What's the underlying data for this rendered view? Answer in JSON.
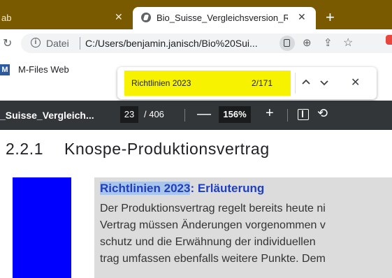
{
  "browser": {
    "prev_tab_label": "ab",
    "active_tab_label": "Bio_Suisse_Vergleichsversion_Ricl",
    "close_glyph": "✕",
    "new_tab_glyph": "+",
    "address": {
      "scheme_label": "Datei",
      "url": "C:/Users/benjamin.janisch/Bio%20Sui..."
    },
    "bookmark": {
      "icon_letter": "M",
      "label": "M-Files Web"
    }
  },
  "find_bar": {
    "query": "Richtlinien 2023",
    "count": "2/171",
    "highlight_color": "#f7f200"
  },
  "pdf_toolbar": {
    "title": "_Suisse_Vergleich...",
    "current_page": "23",
    "total_pages": "/ 406",
    "zoom": "156%"
  },
  "document": {
    "section_number": "2.2.1",
    "section_title": "Knospe-Produktionsvertrag",
    "note_title_highlight": "Richtlinien 2023",
    "note_title_rest": ": Erläuterung",
    "lines": [
      "Der Produktionsvertrag regelt bereits heute ni",
      "Vertrag müssen Änderungen vorgenommen v",
      "schutz und die Erwähnung der individuellen",
      "trag umfassen ebenfalls weitere Punkte. Dem"
    ]
  },
  "colors": {
    "tabstrip": "#7a5a00",
    "pdf_toolbar": "#323639",
    "blue_block": "#0000ff",
    "note_background": "#dcdcdc",
    "note_title": "#1f3fbf"
  }
}
